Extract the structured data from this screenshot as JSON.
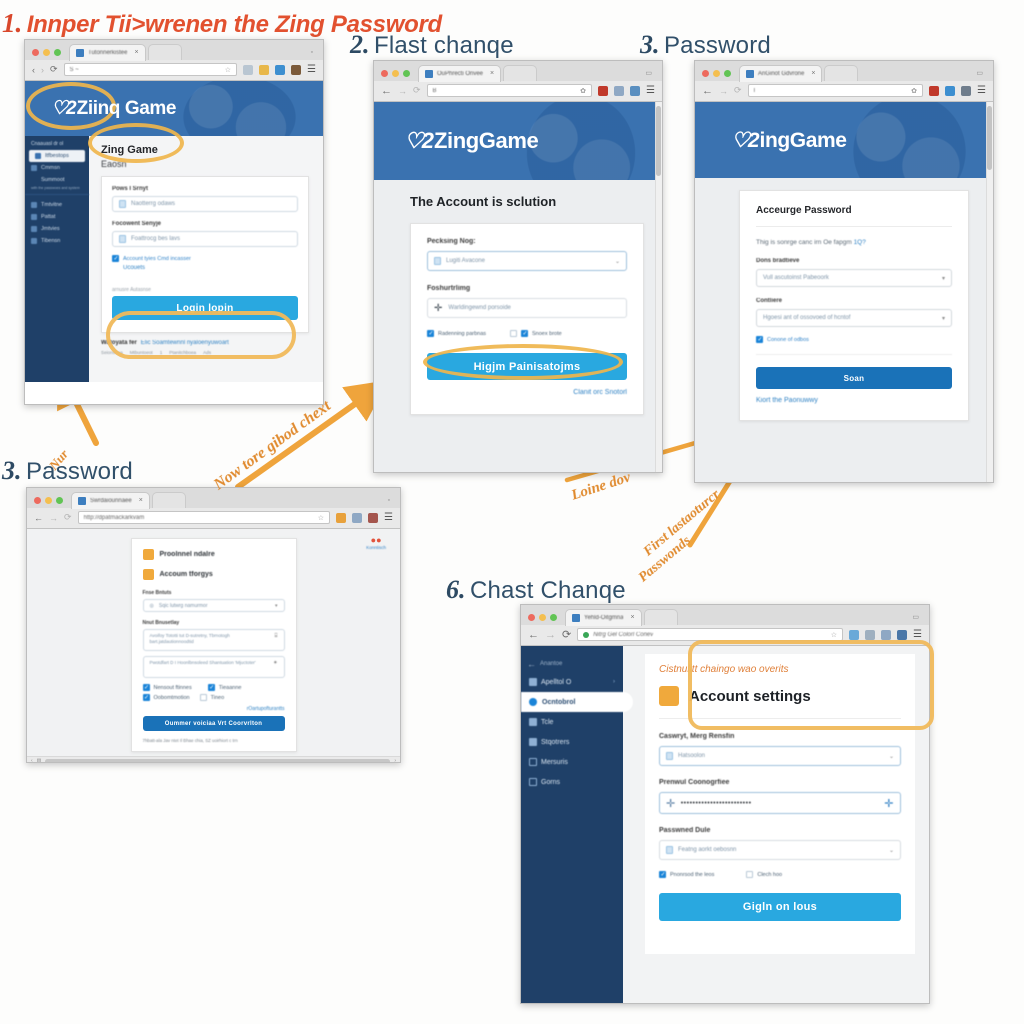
{
  "meta": {
    "kind": "tutorial-collage",
    "background": "#fdfdfc",
    "accent_orange": "#e08a2e",
    "accent_red": "#d9472b",
    "brand_blue": "#3a72b0",
    "button_cyan": "#29a8e0",
    "sidebar_navy": "#1f4068"
  },
  "steps": [
    {
      "num": "1.",
      "title": "Innper Tii>wrenen the Zing Password",
      "style": "red"
    },
    {
      "num": "2.",
      "title": "Flast chanqe",
      "style": "blue"
    },
    {
      "num": "3.",
      "title": "Password",
      "style": "blue"
    },
    {
      "num": "3.",
      "title": "Password",
      "style": "blue"
    },
    {
      "num": "6.",
      "title": "Chast Chanqe",
      "style": "blue"
    }
  ],
  "panel1": {
    "tab_title": "Tutonnerkistee",
    "url": "S ~",
    "banner_logo_mark": "♡2",
    "banner_logo_word": "Ziinq Game",
    "sidebar_caption": "Cnaauasl dr ol",
    "sidebar_items": [
      {
        "label": "Itfbestops",
        "active": true
      },
      {
        "label": "Cmmsn",
        "active": false
      },
      {
        "label": "Summoot",
        "active": false
      },
      {
        "label": "Tmtvitne",
        "active": false
      },
      {
        "label": "Pattat",
        "active": false
      },
      {
        "label": "Jmtvies",
        "active": false
      },
      {
        "label": "Tibensn",
        "active": false
      }
    ],
    "sidebar_subnote": "with the passwoes and system",
    "page_heading": "Zing Game",
    "page_subheading": "Eaosn",
    "field1_label": "Pows I Srnyt",
    "field1_value": "Naotterrg odaws",
    "field2_label": "Focowent Senyje",
    "field2_value": "Foattrocg bes lavs",
    "check_label": "Account tyies Cmd incasser",
    "check_label2": "Ucouets",
    "helper_text": "arnusre Autasnse",
    "submit_label": "Login lopin",
    "footer_text": "Watoyata fer",
    "footer_link": "Elic Soamtewnnl nyaloenyuwoart",
    "footer_items": [
      "Seionst na",
      "Mtbuntoeot",
      "1",
      "Ptanitchboea",
      "Ads"
    ]
  },
  "panel2": {
    "tab_title": "OuPhrecti Onvee",
    "url": "B",
    "banner_logo_mark": "♡2",
    "banner_logo_word": "ZingGame",
    "heading": "The Account is sclution",
    "field1_label": "Pecksing Nog:",
    "field1_value": "Lugiti Avacone",
    "field2_label": "Foshurtrlimg",
    "field2_value": "Warldingewnd porsoide",
    "check1_label": "Radenning parbnas",
    "check1_on": true,
    "check2_label": "Snoex brote",
    "check2_on": true,
    "submit_label": "Higjm Painisatojms",
    "link_label": "Clanit orc Snotorl"
  },
  "panel3": {
    "tab_title": "AriGinot Gdvrone",
    "url": "I",
    "banner_logo_mark": "♡2",
    "banner_logo_word": "ingGame",
    "heading": "Acceurge Password",
    "sub_text": "Thig is sonrge canc irn Oe fapgm",
    "sub_link": "1Q?",
    "field1_label": "Dons bradtieve",
    "field1_value": "Vull ascutoinst Pabeoork",
    "field2_label": "Contliere",
    "field2_value": "Hgoesi ant of ossovoed of hcntof",
    "check_label": "Conone of odbos",
    "check_on": true,
    "submit_label": "Soan",
    "link_label": "Kiort the Paonuwwy"
  },
  "panel4": {
    "tab_title": "Swrdaiounnaee",
    "url": "http://dpatmackarkvam",
    "badge_label": "Konntisch",
    "row1_label": "Proolnnel ndalre",
    "row2_label": "Accoum tforgys",
    "field1_label": "Fnse Bntuts",
    "field1_value": "Sqic lutwrg namurmor",
    "field2_label": "Nnut Bnusetlay",
    "field2_value": "Avoifoy Tototti tut D-sutretny, Tbrnotogh bart.jatdautionnoodtid",
    "field3_value": "Pwotdfart D I Hoonlbnsoleed Shantuation 'Mjuctoter'",
    "check1_label": "Nensout ftinnes",
    "check2_label": "Tieaanne",
    "check3_label": "Oobomtmotion",
    "check4_label": "Tineo",
    "link_label": "rOartupofturantts",
    "submit_label": "Oummer voiciaa Vrt Coorvrlton",
    "footer_text": "7hbatt-ala Jav ntet Il Bhae chia, SZ uoirhiort c trn"
  },
  "panel6": {
    "tab_title": "Yehld-Oitgmna",
    "url": "Nitrg Gel Colorl Conev",
    "nav_back": "Anantoe",
    "sidebar_items": [
      {
        "label": "Apelltol O",
        "active": false
      },
      {
        "label": "Ocntobrol",
        "active": true
      },
      {
        "label": "Tcle",
        "active": false
      },
      {
        "label": "Stqotrers",
        "active": false
      },
      {
        "label": "Mersuris",
        "active": false
      },
      {
        "label": "Gorns",
        "active": false
      }
    ],
    "callout_text": "Cistnulitt chaingo wao overits",
    "section_title": "Account settings",
    "field1_label": "Caswryt, Merg Rensfin",
    "field1_value": "Hatsoolon",
    "field2_label": "Prenwul Coonogrfiee",
    "field2_value": "••••••••••••••••••••••••",
    "field3_label": "Passwned Dule",
    "field3_value": "Featng aorkt oebosnn",
    "check1_label": "Pnonrsod the leos",
    "check1_on": true,
    "check2_label": "Clech hoo",
    "check2_on": false,
    "submit_label": "Gigln on lous"
  },
  "annotations": [
    {
      "text": "Nur",
      "id": "anno-nur"
    },
    {
      "text": "Now tore gibod chext",
      "id": "anno-now-tore"
    },
    {
      "text": "Loine dov",
      "id": "anno-loine-dov"
    },
    {
      "text": "First lastaoturcr",
      "id": "anno-first-last"
    },
    {
      "text": "Passwonds",
      "id": "anno-passwonds"
    }
  ]
}
